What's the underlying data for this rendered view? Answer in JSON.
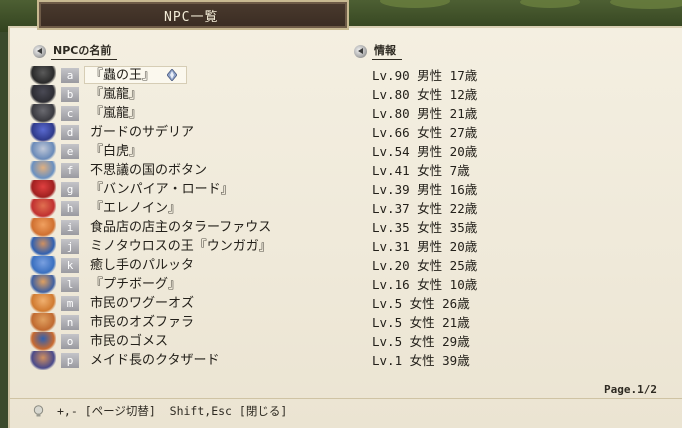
{
  "window": {
    "title": "NPC一覧"
  },
  "columns": {
    "name_header": "NPCの名前",
    "info_header": "情報"
  },
  "npcs": [
    {
      "key": "a",
      "name": "『蟲の王』",
      "info": "Lv.90 男性 17歳",
      "selected": true
    },
    {
      "key": "b",
      "name": "『嵐龍』",
      "info": "Lv.80 女性 12歳"
    },
    {
      "key": "c",
      "name": "『嵐龍』",
      "info": "Lv.80 男性 21歳"
    },
    {
      "key": "d",
      "name": "ガードのサデリア",
      "info": "Lv.66 女性 27歳"
    },
    {
      "key": "e",
      "name": "『白虎』",
      "info": "Lv.54 男性 20歳"
    },
    {
      "key": "f",
      "name": "不思議の国のボタン",
      "info": "Lv.41 女性 7歳"
    },
    {
      "key": "g",
      "name": "『バンパイア・ロード』",
      "info": "Lv.39 男性 16歳"
    },
    {
      "key": "h",
      "name": "『エレノイン』",
      "info": "Lv.37 女性 22歳"
    },
    {
      "key": "i",
      "name": "食品店の店主のタラーファウス",
      "info": "Lv.35 女性 35歳"
    },
    {
      "key": "j",
      "name": "ミノタウロスの王『ウンガガ』",
      "info": "Lv.31 男性 20歳"
    },
    {
      "key": "k",
      "name": "癒し手のパルッタ",
      "info": "Lv.20 女性 25歳"
    },
    {
      "key": "l",
      "name": "『プチボーグ』",
      "info": "Lv.16 女性 10歳"
    },
    {
      "key": "m",
      "name": "市民のワグーオズ",
      "info": "Lv.5 女性 26歳"
    },
    {
      "key": "n",
      "name": "市民のオズファラ",
      "info": "Lv.5 女性 21歳"
    },
    {
      "key": "o",
      "name": "市民のゴメス",
      "info": "Lv.5 女性 29歳"
    },
    {
      "key": "p",
      "name": "メイド長のクタザード",
      "info": "Lv.1 女性 39歳"
    }
  ],
  "pagination": {
    "label": "Page.1/2"
  },
  "footer": {
    "hint": "+,- [ページ切替]  Shift,Esc [閉じる]"
  },
  "icons": {
    "cursor": "diamond-cursor-icon",
    "bullet": "arrow-bullet-icon",
    "hint": "lightbulb-icon"
  },
  "colors": {
    "parchment": "#f1ecdd",
    "title_plate": "#3f3127",
    "key_badge": "#aeaeb4",
    "text": "#23201a"
  }
}
